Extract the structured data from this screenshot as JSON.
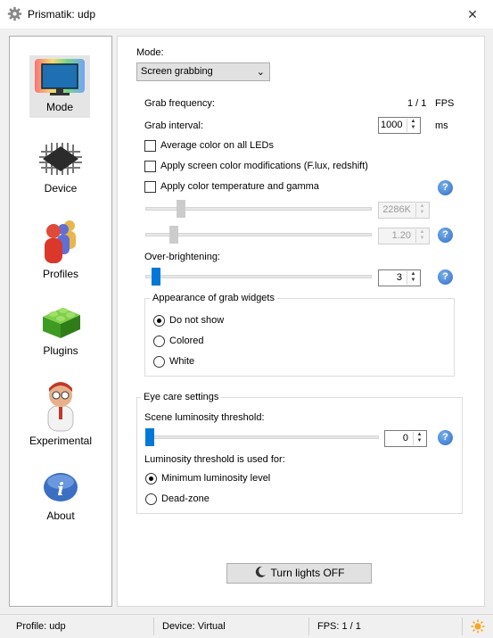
{
  "window": {
    "title": "Prismatik: udp",
    "close_symbol": "✕"
  },
  "sidebar": {
    "items": [
      {
        "label": "Mode"
      },
      {
        "label": "Device"
      },
      {
        "label": "Profiles"
      },
      {
        "label": "Plugins"
      },
      {
        "label": "Experimental"
      },
      {
        "label": "About"
      }
    ]
  },
  "mode": {
    "label": "Mode:",
    "value": "Screen grabbing",
    "arrow": "⌄"
  },
  "grab": {
    "frequency_label": "Grab frequency:",
    "frequency_value": "1 / 1",
    "frequency_unit": "FPS",
    "interval_label": "Grab interval:",
    "interval_value": "1000",
    "interval_unit": "ms"
  },
  "checks": {
    "average": {
      "label": "Average color on all LEDs",
      "checked": false
    },
    "screen_mods": {
      "label": "Apply screen color modifications (F.lux, redshift)",
      "checked": false
    },
    "temperature": {
      "label": "Apply color temperature and gamma",
      "checked": false
    }
  },
  "temperature": {
    "value": "2286K"
  },
  "gamma": {
    "value": "1.20"
  },
  "overbright": {
    "label": "Over-brightening:",
    "value": "3"
  },
  "widgets": {
    "title": "Appearance of grab widgets",
    "options": [
      "Do not show",
      "Colored",
      "White"
    ],
    "selected": "Do not show"
  },
  "eyecare": {
    "title": "Eye care settings",
    "scene_label": "Scene luminosity threshold:",
    "scene_value": "0",
    "used_for_label": "Luminosity threshold is used for:",
    "options": [
      "Minimum luminosity level",
      "Dead-zone"
    ],
    "selected": "Minimum luminosity level"
  },
  "lights_button": {
    "label": "Turn lights OFF"
  },
  "status": {
    "profile": "Profile: udp",
    "device": "Device: Virtual",
    "fps": "FPS: 1 / 1"
  },
  "colors": {
    "accent": "#0078d7",
    "help": "#2f6dc4",
    "sun": "#f5a623"
  },
  "spin_arrows": {
    "up": "▲",
    "down": "▼"
  }
}
